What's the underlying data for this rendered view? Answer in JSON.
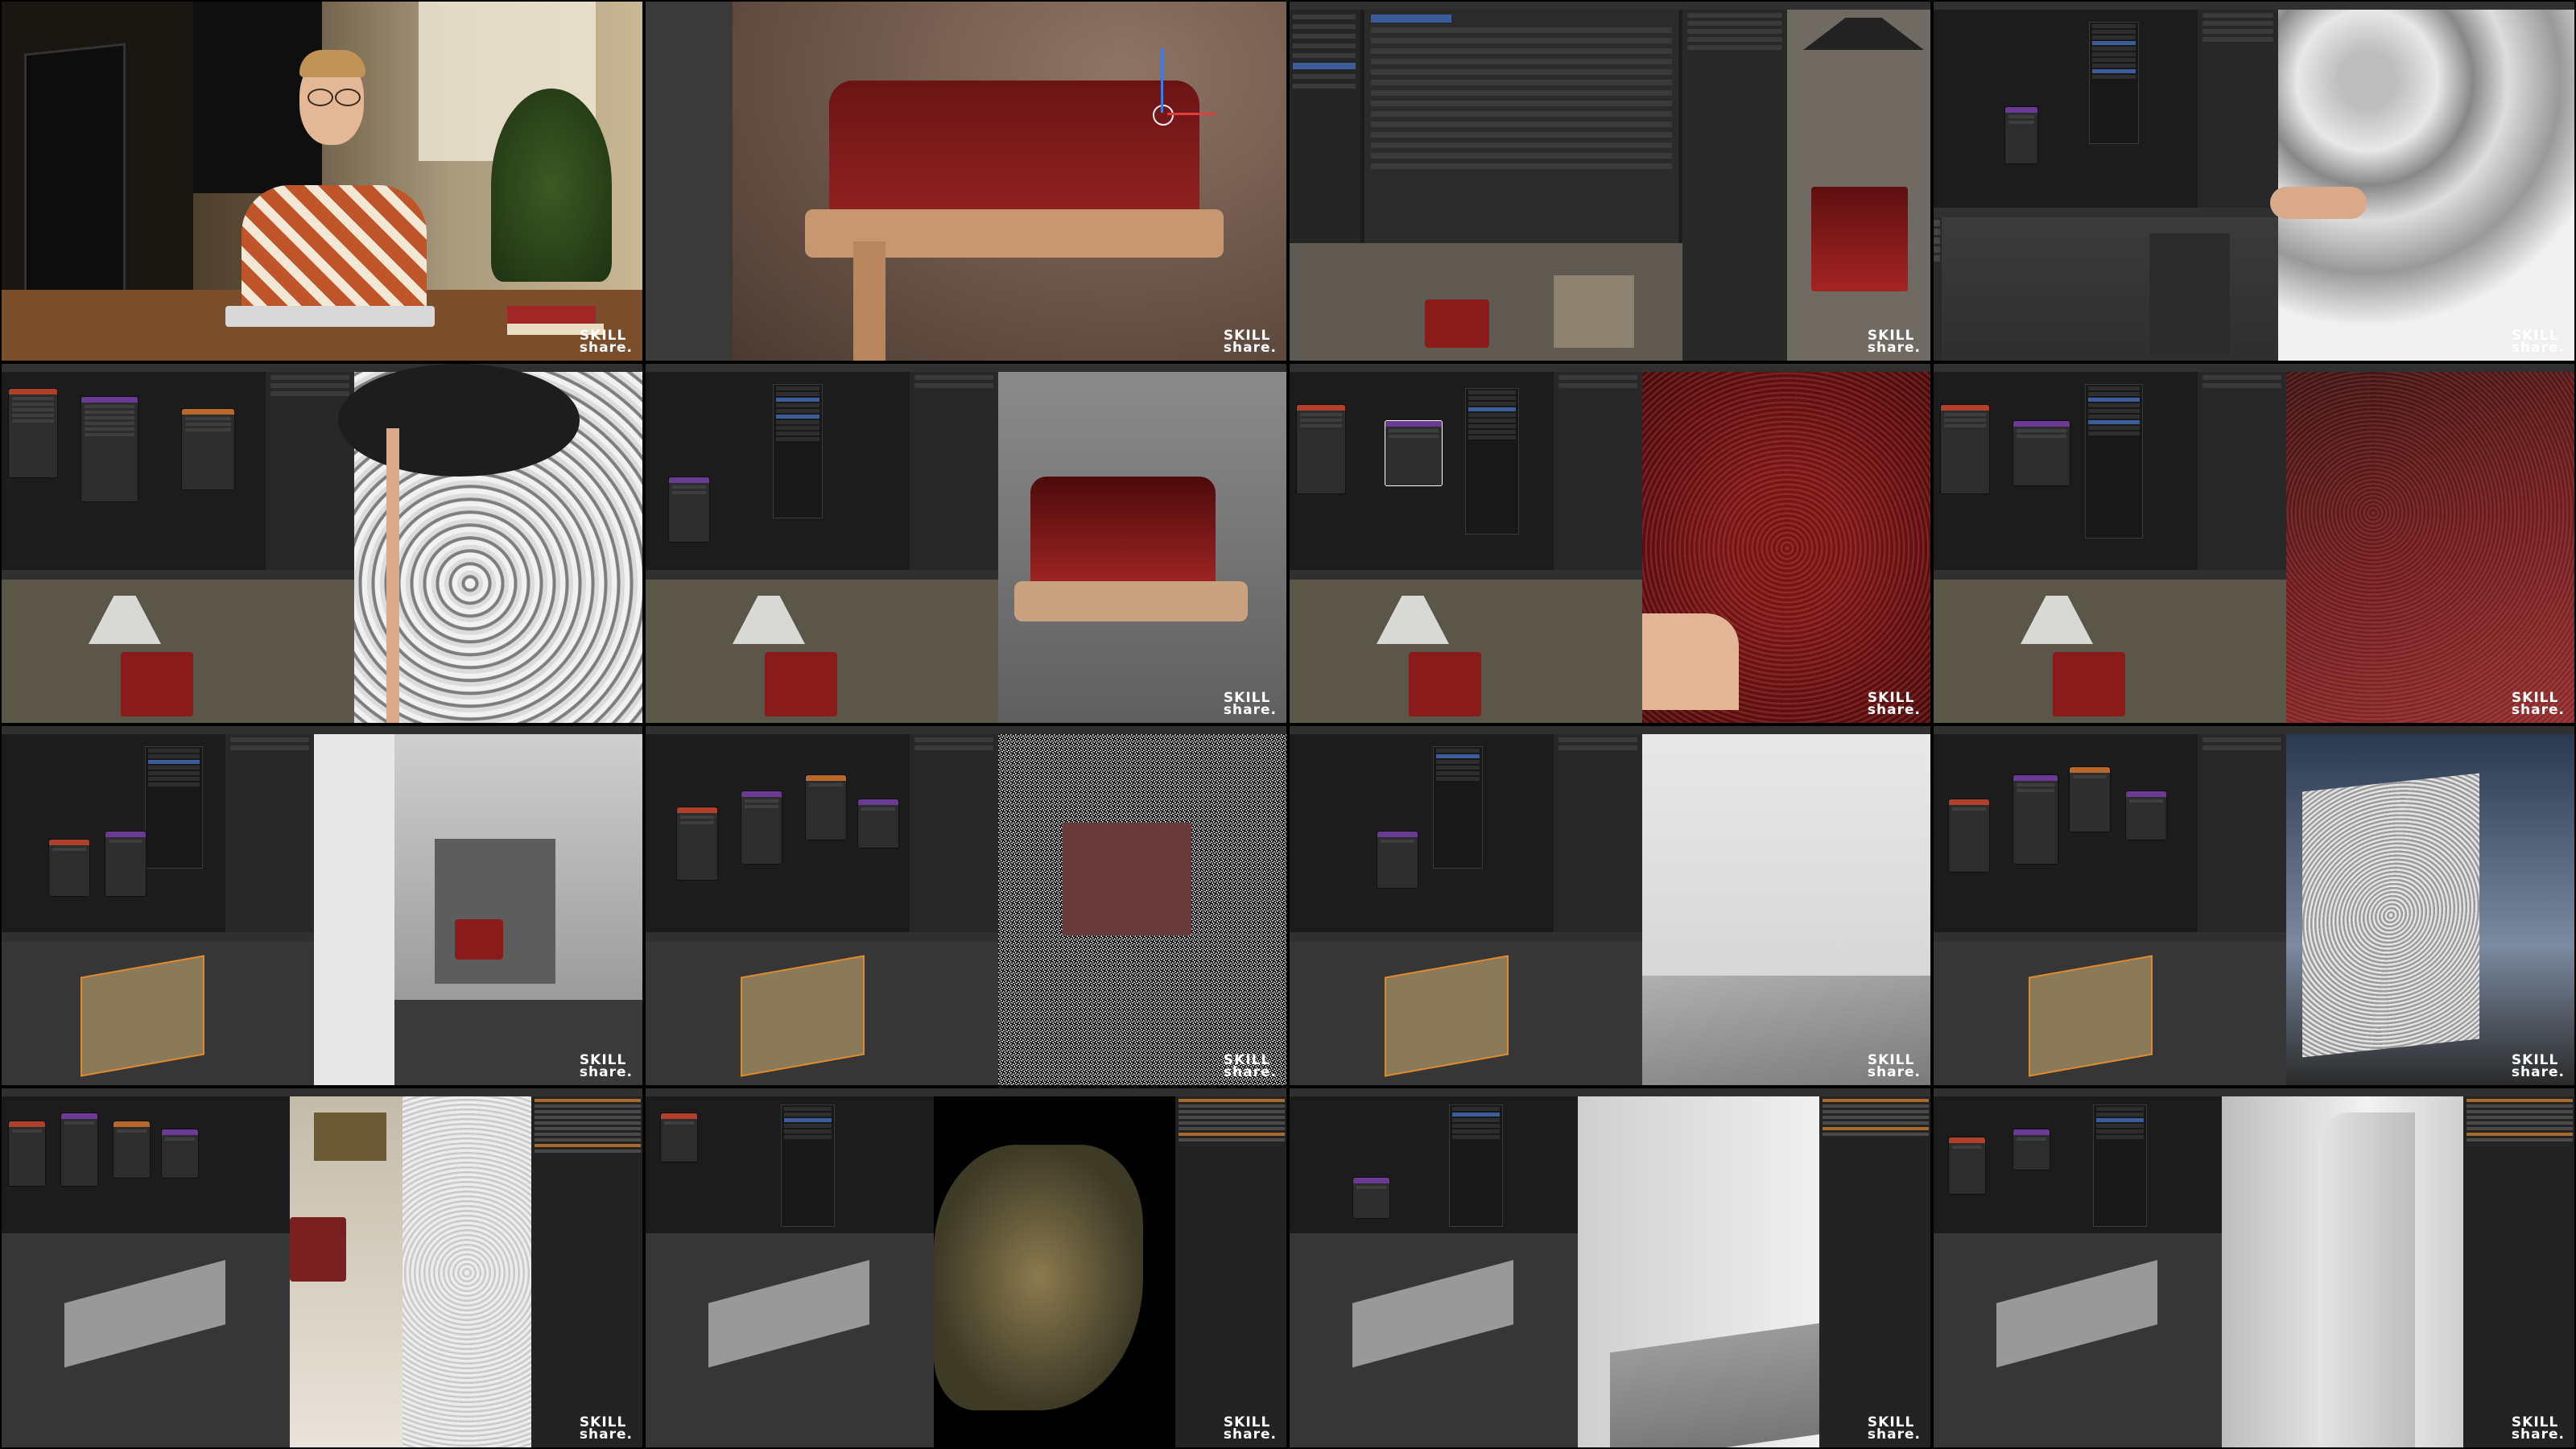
{
  "brand": {
    "watermark_line1": "SKILL",
    "watermark_line2": "share."
  },
  "colors": {
    "blender_bg": "#1d1d1d",
    "header": "#303030",
    "leather_red": "#8a1b1b",
    "accent_blue": "#3b5d9a",
    "orange_select": "#e08a2c"
  },
  "icons": [
    "move-gizmo-icon",
    "axis-gizmo-icon",
    "tool-icon"
  ],
  "tiles": [
    {
      "id": "t1",
      "type": "presenter"
    },
    {
      "id": "t2",
      "type": "closeup-chair-gizmo"
    },
    {
      "id": "t3",
      "type": "preferences-addons"
    },
    {
      "id": "t4",
      "type": "noise-texture-chair"
    },
    {
      "id": "t5",
      "type": "node-mapping-grey"
    },
    {
      "id": "t6",
      "type": "node-red-chair"
    },
    {
      "id": "t7",
      "type": "bump-closeup-red"
    },
    {
      "id": "t8",
      "type": "bump-closeup-red-2"
    },
    {
      "id": "t9",
      "type": "plane-room-render"
    },
    {
      "id": "t10",
      "type": "noisy-render-chair"
    },
    {
      "id": "t11",
      "type": "plane-white-render"
    },
    {
      "id": "t12",
      "type": "plane-rough-render"
    },
    {
      "id": "t13",
      "type": "room-wall-render"
    },
    {
      "id": "t14",
      "type": "painting-alpha-render"
    },
    {
      "id": "t15",
      "type": "curtain-render"
    },
    {
      "id": "t16",
      "type": "curtain-render-2"
    }
  ]
}
